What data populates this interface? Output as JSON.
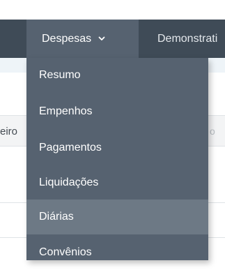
{
  "navbar": {
    "despesas_label": "Despesas",
    "demonstrativos_label": "Demonstrati"
  },
  "table": {
    "left_header_fragment": "eiro",
    "right_header_fragment": "o"
  },
  "dropdown": {
    "items": [
      {
        "label": "Resumo"
      },
      {
        "label": "Empenhos"
      },
      {
        "label": "Pagamentos"
      },
      {
        "label": "Liquidações"
      },
      {
        "label": "Diárias",
        "hovered": true
      },
      {
        "label": "Convênios"
      }
    ]
  },
  "colors": {
    "navbar_bg": "#3f4b57",
    "active_nav_bg": "#566270",
    "dropdown_bg": "#566270",
    "dropdown_hover_bg": "#6d7985"
  }
}
